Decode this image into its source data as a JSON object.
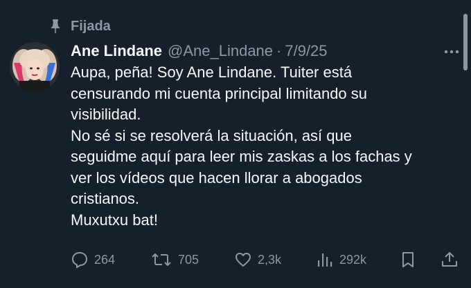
{
  "pinned": {
    "label": "Fijada",
    "icon": "pin-icon"
  },
  "author": {
    "display_name": "Ane Lindane",
    "handle": "@Ane_Lindane",
    "separator": "·",
    "date": "7/9/25",
    "avatar": "avatar"
  },
  "more": {
    "icon": "more-horizontal-icon"
  },
  "tweet": {
    "lines": [
      "Aupa, peña! Soy Ane Lindane. Tuiter está",
      "censurando mi cuenta principal limitando su",
      "visibilidad.",
      "No sé si se resolverá la situación, así que",
      "seguidme aquí para leer mis zaskas a los fachas y",
      "ver los vídeos que hacen llorar a abogados",
      "cristianos.",
      "Muxutxu bat!"
    ]
  },
  "actions": {
    "reply": {
      "count": "264",
      "icon": "reply-icon"
    },
    "retweet": {
      "count": "705",
      "icon": "retweet-icon"
    },
    "like": {
      "count": "2,3k",
      "icon": "heart-icon"
    },
    "views": {
      "count": "292k",
      "icon": "analytics-icon"
    },
    "bookmark": {
      "icon": "bookmark-icon"
    },
    "share": {
      "icon": "share-icon"
    }
  },
  "colors": {
    "background": "#15202b",
    "primary_text": "#f7f9f9",
    "secondary_text": "#8b98a5"
  }
}
